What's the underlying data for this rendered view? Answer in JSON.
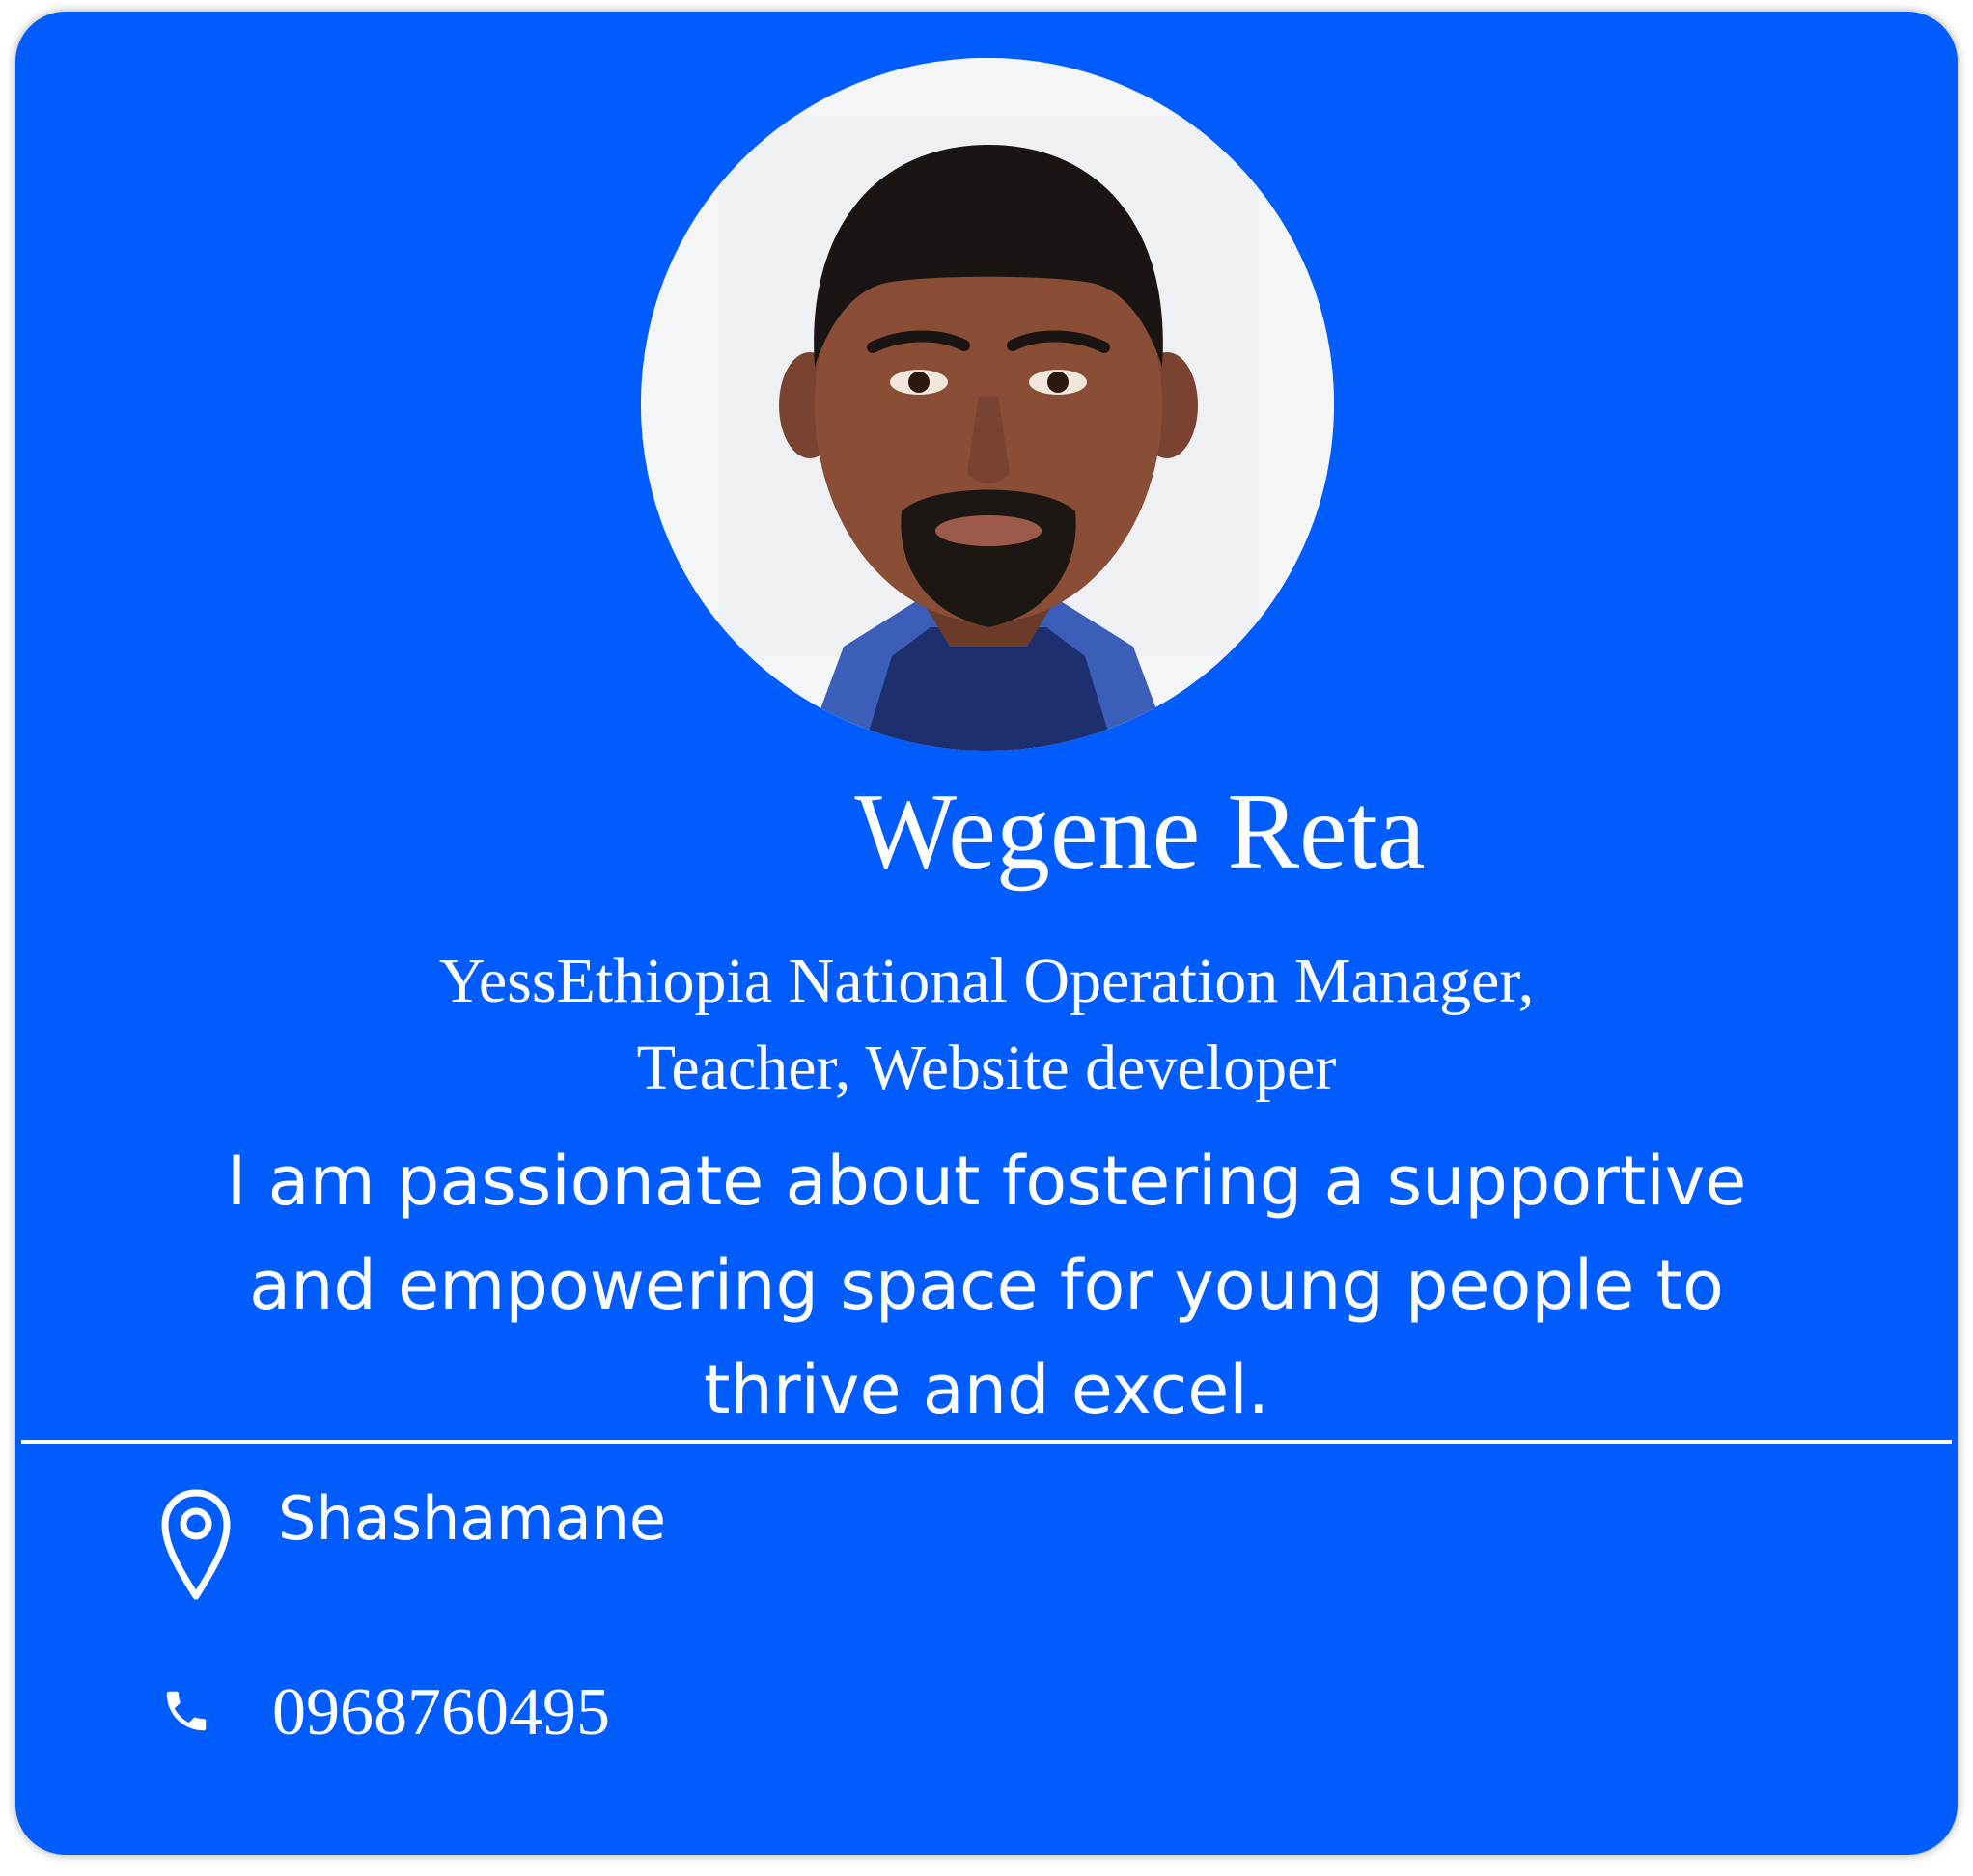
{
  "profile": {
    "name": "Wegene Reta",
    "role_lines": [
      "YessEthiopia National Operation Manager,",
      "Teacher, Website developer"
    ],
    "bio_lines": [
      "I am passionate about fostering a supportive",
      "and empowering space for young people to",
      "thrive and excel."
    ]
  },
  "contact": {
    "location": "Shashamane",
    "location_icon": "map-pin-icon",
    "phone": "0968760495",
    "phone_icon": "phone-icon"
  },
  "colors": {
    "card_background": "#005cfc",
    "text": "#ffffff"
  }
}
